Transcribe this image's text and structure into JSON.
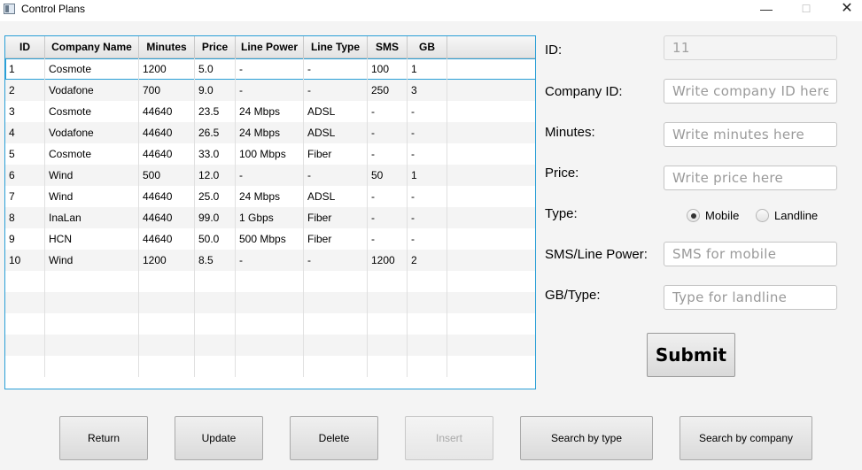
{
  "window": {
    "title": "Control Plans",
    "controls": {
      "minimize": "—",
      "maximize": "☐",
      "close": "✕"
    }
  },
  "table": {
    "columns": [
      "ID",
      "Company Name",
      "Minutes",
      "Price",
      "Line Power",
      "Line Type",
      "SMS",
      "GB"
    ],
    "rows": [
      [
        "1",
        "Cosmote",
        "1200",
        "5.0",
        "-",
        "-",
        "100",
        "1"
      ],
      [
        "2",
        "Vodafone",
        "700",
        "9.0",
        "-",
        "-",
        "250",
        "3"
      ],
      [
        "3",
        "Cosmote",
        "44640",
        "23.5",
        "24 Mbps",
        "ADSL",
        "-",
        "-"
      ],
      [
        "4",
        "Vodafone",
        "44640",
        "26.5",
        "24 Mbps",
        "ADSL",
        "-",
        "-"
      ],
      [
        "5",
        "Cosmote",
        "44640",
        "33.0",
        "100 Mbps",
        "Fiber",
        "-",
        "-"
      ],
      [
        "6",
        "Wind",
        "500",
        "12.0",
        "-",
        "-",
        "50",
        "1"
      ],
      [
        "7",
        "Wind",
        "44640",
        "25.0",
        "24 Mbps",
        "ADSL",
        "-",
        "-"
      ],
      [
        "8",
        "InaLan",
        "44640",
        "99.0",
        "1 Gbps",
        "Fiber",
        "-",
        "-"
      ],
      [
        "9",
        "HCN",
        "44640",
        "50.0",
        "500 Mbps",
        "Fiber",
        "-",
        "-"
      ],
      [
        "10",
        "Wind",
        "1200",
        "8.5",
        "-",
        "-",
        "1200",
        "2"
      ]
    ],
    "selected_row": 0
  },
  "form": {
    "id_label": "ID:",
    "id_value": "11",
    "company_label": "Company ID:",
    "company_placeholder": "Write company ID here",
    "minutes_label": "Minutes:",
    "minutes_placeholder": "Write minutes here",
    "price_label": "Price:",
    "price_placeholder": "Write price here",
    "type_label": "Type:",
    "type_options": [
      "Mobile",
      "Landline"
    ],
    "type_selected": "Mobile",
    "sms_label": "SMS/Line Power:",
    "sms_placeholder": "SMS for mobile",
    "gb_label": "GB/Type:",
    "gb_placeholder": "Type for landline",
    "submit_label": "Submit"
  },
  "buttons": {
    "return": "Return",
    "update": "Update",
    "delete": "Delete",
    "insert": "Insert",
    "search_type": "Search by type",
    "search_company": "Search by company"
  }
}
